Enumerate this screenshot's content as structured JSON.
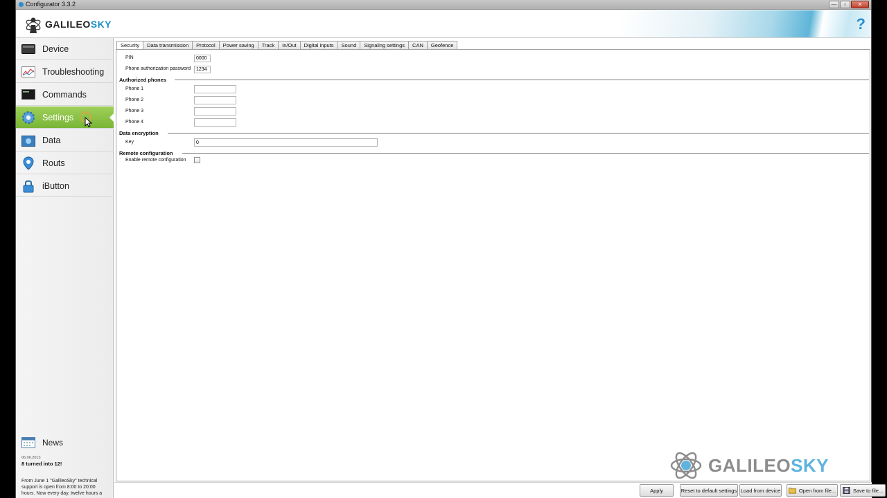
{
  "window": {
    "title": "Configurator 3.3.2",
    "controls": [
      "—",
      "▫",
      "✕"
    ]
  },
  "header": {
    "brand_part1": "GALILEO",
    "brand_part2": "SKY",
    "help_label": "?"
  },
  "sidebar": {
    "items": [
      {
        "label": "Device",
        "icon": "device-icon"
      },
      {
        "label": "Troubleshooting",
        "icon": "troubleshooting-icon"
      },
      {
        "label": "Commands",
        "icon": "commands-icon"
      },
      {
        "label": "Settings",
        "icon": "gear-icon",
        "active": true
      },
      {
        "label": "Data",
        "icon": "data-icon"
      },
      {
        "label": "Routs",
        "icon": "map-pin-icon"
      },
      {
        "label": "iButton",
        "icon": "lock-icon"
      }
    ],
    "news": {
      "label": "News",
      "date": "06.06.2013",
      "headline": "8 turned into 12!",
      "body": "From June 1 \"GalileoSky\" technical support is open from 8:00 to 20:00 hours. Now every day, twelve hours a"
    }
  },
  "tabs": [
    "Security",
    "Data transmission",
    "Protocol",
    "Power saving",
    "Track",
    "In/Out",
    "Digital inputs",
    "Sound",
    "Signaling settings",
    "CAN",
    "Geofence"
  ],
  "security": {
    "pin_label": "PIN",
    "pin_value": "0000",
    "phone_password_label": "Phone authorization password",
    "phone_password_value": "1234",
    "authorized_phones_title": "Authorized phones",
    "phone1_label": "Phone 1",
    "phone2_label": "Phone 2",
    "phone3_label": "Phone 3",
    "phone4_label": "Phone 4",
    "phone1_value": "",
    "phone2_value": "",
    "phone3_value": "",
    "phone4_value": "",
    "data_encryption_title": "Data encryption",
    "key_label": "Key",
    "key_value": "0",
    "remote_config_title": "Remote configuration",
    "enable_remote_label": "Enable remote configuration",
    "enable_remote_checked": false
  },
  "watermark": {
    "brand_part1": "GALILEO",
    "brand_part2": "SKY"
  },
  "bottom_buttons": {
    "apply": "Apply",
    "reset": "Reset to default settings",
    "load": "Load from device",
    "open": "Open from file...",
    "save": "Save to file..."
  },
  "colors": {
    "active_nav": "#8cc447",
    "brand_blue": "#1e8ec7",
    "watermark_blue": "#5fb3de"
  }
}
